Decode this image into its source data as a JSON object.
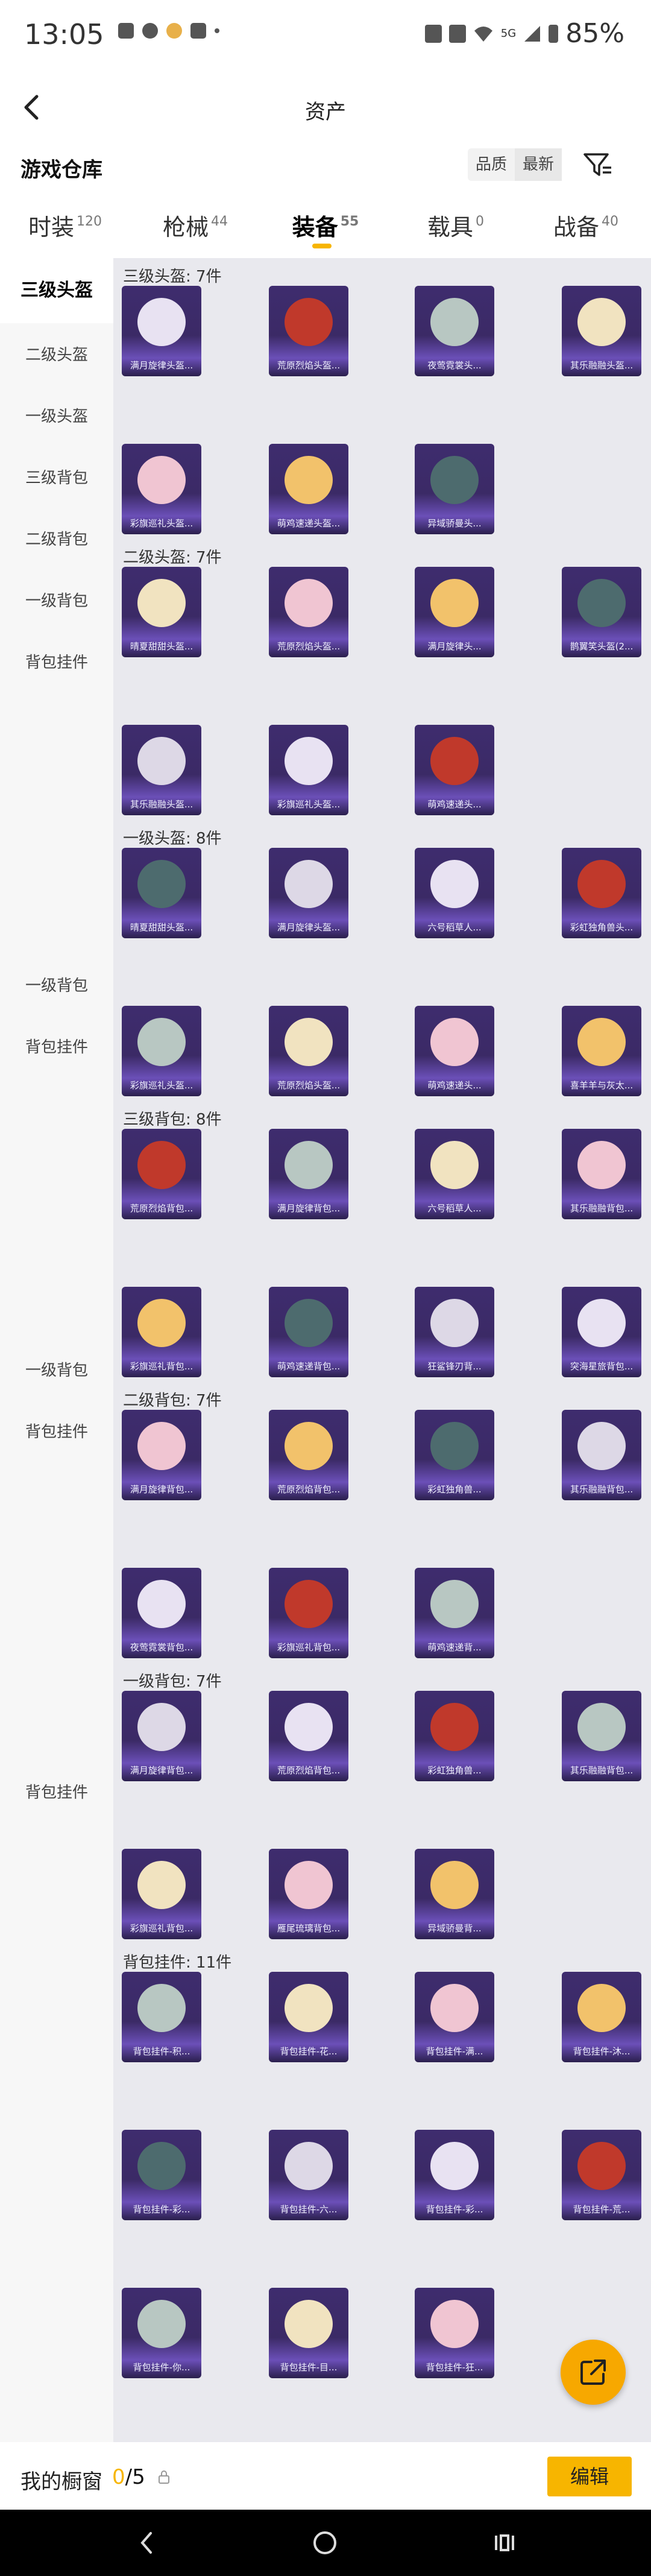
{
  "status_bar": {
    "time": "13:05",
    "battery": "85%",
    "network": "5G"
  },
  "header": {
    "title": "资产",
    "back_icon": "chevron-left-icon"
  },
  "warehouse": {
    "title": "游戏仓库",
    "sort_options": [
      "品质",
      "最新"
    ],
    "filter_icon": "filter-icon"
  },
  "tabs": [
    {
      "label": "时装",
      "count": "120"
    },
    {
      "label": "枪械",
      "count": "44"
    },
    {
      "label": "装备",
      "count": "55",
      "active": true
    },
    {
      "label": "载具",
      "count": "0"
    },
    {
      "label": "战备",
      "count": "40"
    }
  ],
  "sidebar": [
    {
      "label": "三级头盔",
      "active": true
    },
    {
      "label": "二级头盔"
    },
    {
      "label": "一级头盔"
    },
    {
      "label": "三级背包"
    },
    {
      "label": "二级背包"
    },
    {
      "label": "一级背包"
    },
    {
      "label": "背包挂件"
    },
    {
      "label": "一级背包"
    },
    {
      "label": "背包挂件"
    },
    {
      "label": "一级背包"
    },
    {
      "label": "背包挂件"
    },
    {
      "label": "背包挂件"
    }
  ],
  "sections": [
    {
      "title": "三级头盔: 7件",
      "items": [
        "满月旋律头盔...",
        "荒原烈焰头盔...",
        "夜莺霓裳头...",
        "其乐融融头盔...",
        "彩旗巡礼头盔...",
        "萌鸡速递头盔...",
        "异域骄曼头..."
      ]
    },
    {
      "title": "二级头盔: 7件",
      "items": [
        "晴夏甜甜头盔...",
        "荒原烈焰头盔...",
        "满月旋律头...",
        "鹊翼笑头盔(2...",
        "其乐融融头盔...",
        "彩旗巡礼头盔...",
        "萌鸡速递头..."
      ]
    },
    {
      "title": "一级头盔: 8件",
      "items": [
        "晴夏甜甜头盔...",
        "满月旋律头盔...",
        "六号稻草人...",
        "彩虹独角兽头...",
        "彩旗巡礼头盔...",
        "荒原烈焰头盔...",
        "萌鸡速递头...",
        "喜羊羊与灰太..."
      ]
    },
    {
      "title": "三级背包: 8件",
      "items": [
        "荒原烈焰背包...",
        "满月旋律背包...",
        "六号稻草人...",
        "其乐融融背包...",
        "彩旗巡礼背包...",
        "萌鸡速递背包...",
        "狂鲨锋刃背...",
        "突海星旅背包..."
      ]
    },
    {
      "title": "二级背包: 7件",
      "items": [
        "满月旋律背包...",
        "荒原烈焰背包...",
        "彩虹独角兽...",
        "其乐融融背包...",
        "夜莺霓裳背包...",
        "彩旗巡礼背包...",
        "萌鸡速递背..."
      ]
    },
    {
      "title": "一级背包: 7件",
      "items": [
        "满月旋律背包...",
        "荒原烈焰背包...",
        "彩虹独角兽...",
        "其乐融融背包...",
        "彩旗巡礼背包...",
        "雁尾琉璃背包...",
        "异域骄曼背..."
      ]
    },
    {
      "title": "背包挂件: 11件",
      "items": [
        "背包挂件-积...",
        "背包挂件-花...",
        "背包挂件-满...",
        "背包挂件-沐...",
        "背包挂件-彩...",
        "背包挂件-六...",
        "背包挂件-彩...",
        "背包挂件-荒...",
        "背包挂件-你...",
        "背包挂件-目...",
        "背包挂件-狂..."
      ]
    }
  ],
  "bottom": {
    "showcase_label": "我的橱窗",
    "showcase_current": "0",
    "showcase_total": "/5",
    "edit_label": "编辑"
  },
  "colors": {
    "accent": "#f7b500",
    "item_bg": "#3e2c6e",
    "content_bg": "#e9e9ee"
  }
}
